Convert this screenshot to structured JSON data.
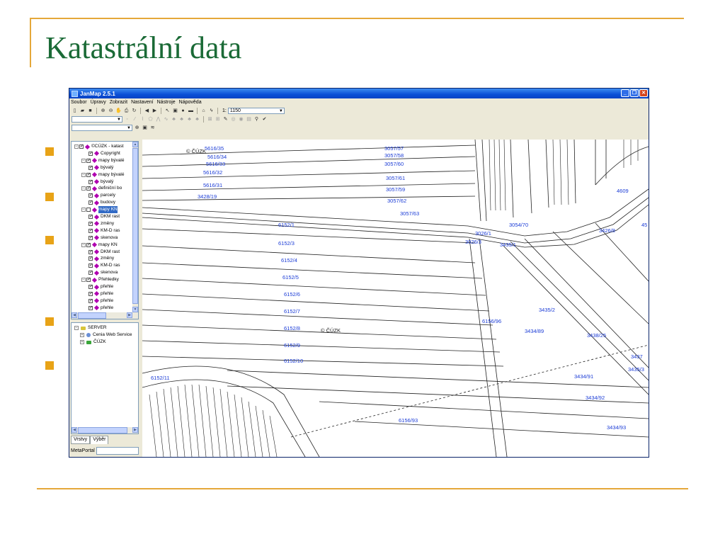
{
  "slide": {
    "title": "Katastrální data",
    "accent_color": "#e5a83a",
    "title_color": "#1a6a36",
    "bullet_color": "#e8a317"
  },
  "app": {
    "title": "JanMap 2.5.1",
    "window_buttons": [
      "minimize-icon",
      "maximize-icon",
      "close-icon"
    ],
    "menu": [
      "Soubor",
      "Úpravy",
      "Zobrazit",
      "Nastavení",
      "Nástroje",
      "Nápověda"
    ],
    "scale_prefix": "1:",
    "scale_value": "1150"
  },
  "layers_tree": {
    "items": [
      {
        "label": "©CÚZK - katast",
        "indent": 0,
        "type": "root"
      },
      {
        "label": "Copyright",
        "indent": 2,
        "type": "leaf"
      },
      {
        "label": "mapy bývalé",
        "indent": 1,
        "type": "group"
      },
      {
        "label": "bývalý",
        "indent": 2,
        "type": "leaf"
      },
      {
        "label": "mapy bývalé",
        "indent": 1,
        "type": "group"
      },
      {
        "label": "bývalý",
        "indent": 2,
        "type": "leaf"
      },
      {
        "label": "definiční bo",
        "indent": 1,
        "type": "group"
      },
      {
        "label": "parcely",
        "indent": 2,
        "type": "leaf"
      },
      {
        "label": "budovy",
        "indent": 2,
        "type": "leaf"
      },
      {
        "label": "mapy KN",
        "indent": 1,
        "type": "group",
        "selected": true,
        "unchecked": true
      },
      {
        "label": "DKM rast",
        "indent": 2,
        "type": "leaf"
      },
      {
        "label": "změny",
        "indent": 2,
        "type": "leaf"
      },
      {
        "label": "KM-D ras",
        "indent": 2,
        "type": "leaf"
      },
      {
        "label": "skenova",
        "indent": 2,
        "type": "leaf"
      },
      {
        "label": "mapy KN",
        "indent": 1,
        "type": "group"
      },
      {
        "label": "DKM rast",
        "indent": 2,
        "type": "leaf"
      },
      {
        "label": "změny",
        "indent": 2,
        "type": "leaf"
      },
      {
        "label": "KM-D ras",
        "indent": 2,
        "type": "leaf"
      },
      {
        "label": "skenova",
        "indent": 2,
        "type": "leaf"
      },
      {
        "label": "Přehledky",
        "indent": 1,
        "type": "group"
      },
      {
        "label": "přehle",
        "indent": 2,
        "type": "leaf"
      },
      {
        "label": "přehle",
        "indent": 2,
        "type": "leaf"
      },
      {
        "label": "přehle",
        "indent": 2,
        "type": "leaf"
      },
      {
        "label": "přehle",
        "indent": 2,
        "type": "leaf"
      }
    ]
  },
  "server_tree": {
    "items": [
      {
        "label": "SERVER",
        "indent": 0,
        "icon": "server-icon"
      },
      {
        "label": "Cenia Web Service",
        "indent": 1,
        "icon": "globe-icon"
      },
      {
        "label": "ČÚZK",
        "indent": 1,
        "icon": "server-icon"
      }
    ]
  },
  "tabs": [
    "Vrstvy",
    "Výběr"
  ],
  "metaportal_label": "MetaPortal",
  "map": {
    "copyright": "© ČÚZK",
    "copyright_center": "© ČÚZK",
    "parcels": [
      "5616/35",
      "5616/34",
      "5616/33",
      "5616/32",
      "5616/31",
      "3428/19",
      "3057/57",
      "3057/58",
      "3057/60",
      "3057/61",
      "3057/59",
      "3057/62",
      "3057/63",
      "6152/1",
      "6152/3",
      "6152/4",
      "6152/5",
      "6152/6",
      "6152/7",
      "6152/8",
      "6152/9",
      "6152/10",
      "6152/11",
      "3026/1",
      "3026/3",
      "3054/70",
      "3435/1",
      "3426/8",
      "4609",
      "45",
      "6156/96",
      "3434/89",
      "3438/25",
      "3435/2",
      "3434/91",
      "3434/92",
      "3434/93",
      "6156/93",
      "3435/3",
      "3437"
    ]
  }
}
